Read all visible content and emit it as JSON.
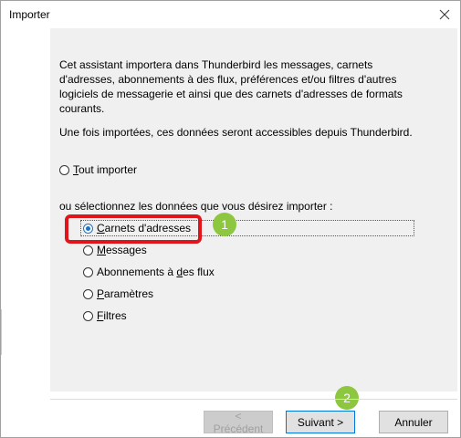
{
  "window": {
    "title": "Importer",
    "close_icon": "close-icon"
  },
  "intro": {
    "paragraph": "Cet assistant importera dans Thunderbird les messages, carnets d'adresses, abonnements à des flux, préférences et/ou filtres d'autres logiciels de messagerie et ainsi que des carnets d'adresses de formats courants.",
    "subline": "Une fois importées, ces données seront accessibles depuis Thunderbird."
  },
  "import_all": {
    "first": "T",
    "rest": "out importer",
    "checked": false
  },
  "selection_label": "ou sélectionnez les données que vous désirez importer :",
  "options": [
    {
      "pre": "",
      "u": "C",
      "post": "arnets d'adresses",
      "checked": true
    },
    {
      "pre": "",
      "u": "M",
      "post": "essages",
      "checked": false
    },
    {
      "pre": "Abonnements à ",
      "u": "d",
      "post": "es flux",
      "checked": false
    },
    {
      "pre": "",
      "u": "P",
      "post": "aramètres",
      "checked": false
    },
    {
      "pre": "",
      "u": "F",
      "post": "iltres",
      "checked": false
    }
  ],
  "badges": {
    "one": "1",
    "two": "2"
  },
  "buttons": {
    "previous": "< Précédent",
    "next": "Suivant >",
    "cancel": "Annuler"
  },
  "colors": {
    "highlight": "#e0151c",
    "badge": "#8dc63f",
    "panel": "#f0f0f0"
  }
}
